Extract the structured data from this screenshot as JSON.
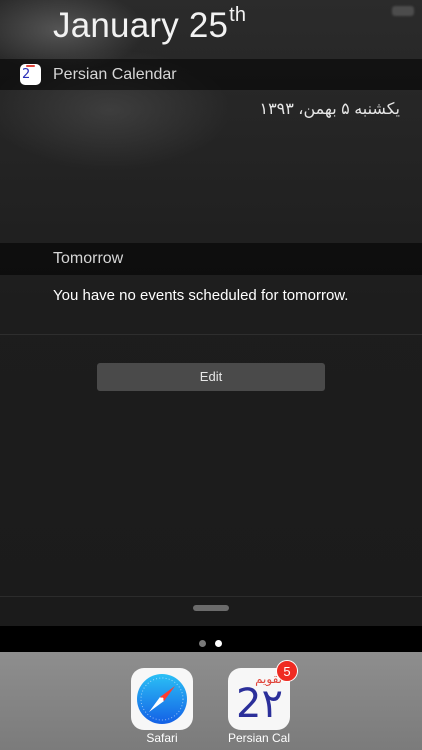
{
  "header": {
    "date_main": "January 25",
    "date_suffix": "th"
  },
  "widget": {
    "app_name": "Persian Calendar",
    "app_icon_num": "2",
    "persian_date": "یکشنبه ۵ بهمن، ۱۳۹۳"
  },
  "tomorrow": {
    "title": "Tomorrow",
    "message": "You have no events scheduled for tomorrow."
  },
  "edit": {
    "label": "Edit"
  },
  "page_indicator": {
    "count": 2,
    "current": 2
  },
  "dock": {
    "apps": [
      {
        "label": "Safari",
        "icon": "safari-compass-icon"
      },
      {
        "label": "Persian Cal",
        "icon": "persian-calendar-icon",
        "badge": "5",
        "icon_text": "تقویم",
        "icon_num": "2"
      }
    ]
  },
  "colors": {
    "badge": "#ef2b22",
    "safari_blue": "#1a8cf2",
    "persian_blue": "#2b2f9a",
    "persian_red": "#e0443a"
  }
}
